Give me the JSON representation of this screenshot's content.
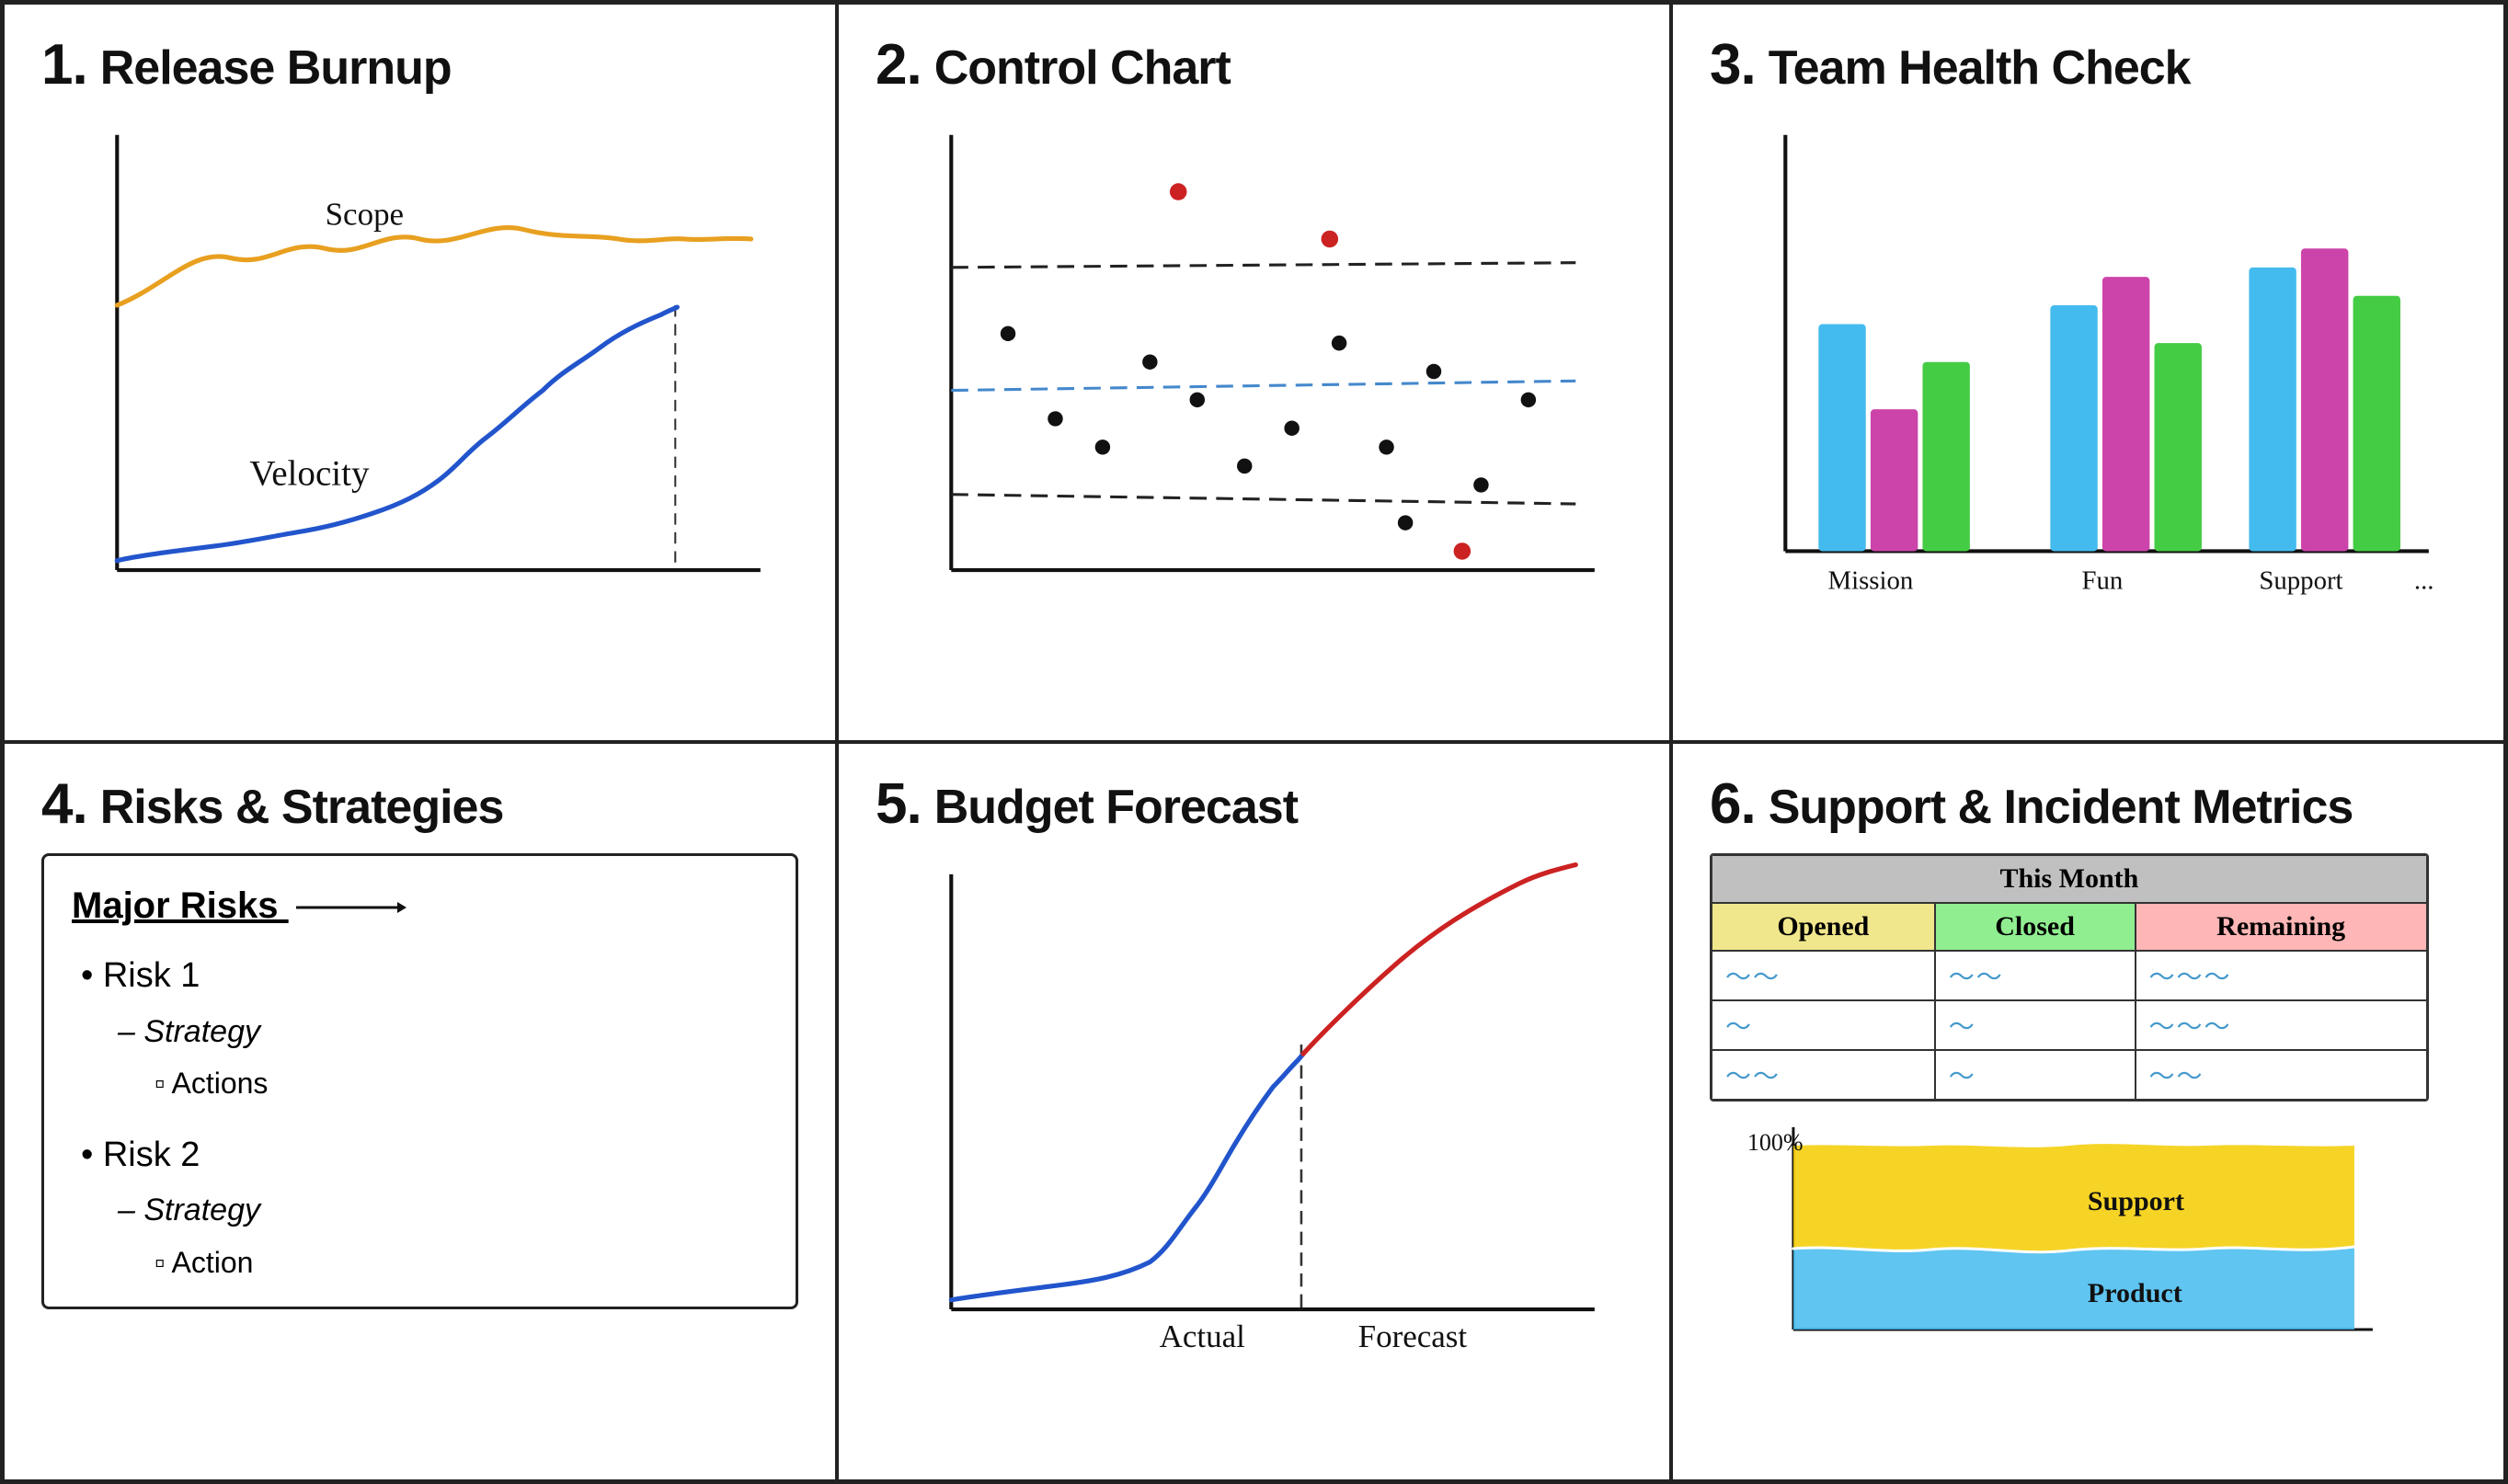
{
  "cells": [
    {
      "num": "1.",
      "title": "Release Burnup",
      "scope_label": "Scope",
      "velocity_label": "Velocity"
    },
    {
      "num": "2.",
      "title": "Control Chart"
    },
    {
      "num": "3.",
      "title": "Team Health Check",
      "x_labels": [
        "Mission",
        "Fun",
        "Support",
        "..."
      ]
    },
    {
      "num": "4.",
      "title": "Risks & Strategies",
      "box_title": "Major Risks",
      "risks": [
        {
          "label": "Risk 1",
          "strategy": "Strategy",
          "action": "Actions"
        },
        {
          "label": "Risk 2",
          "strategy": "Strategy",
          "action": "Action"
        }
      ]
    },
    {
      "num": "5.",
      "title": "Budget Forecast",
      "actual_label": "Actual",
      "forecast_label": "Forecast"
    },
    {
      "num": "6.",
      "title": "Support & Incident Metrics",
      "table": {
        "header_month": "This Month",
        "col_opened": "Opened",
        "col_closed": "Closed",
        "col_remaining": "Remaining"
      },
      "area_labels": [
        "Support",
        "Product"
      ],
      "percent_label": "100%"
    }
  ]
}
